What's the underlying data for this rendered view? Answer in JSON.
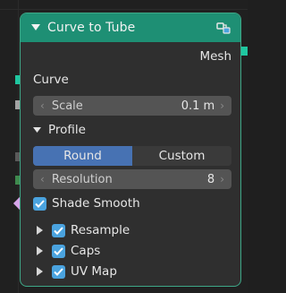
{
  "node": {
    "title": "Curve to Tube",
    "output_label": "Mesh",
    "input_curve_label": "Curve",
    "scale": {
      "label": "Scale",
      "value": "0.1 m"
    },
    "profile": {
      "label": "Profile",
      "options": [
        "Round",
        "Custom"
      ],
      "selected": "Round"
    },
    "resolution": {
      "label": "Resolution",
      "value": "8"
    },
    "shade_smooth": {
      "label": "Shade Smooth",
      "checked": true
    },
    "panels": [
      {
        "label": "Resample",
        "checked": true
      },
      {
        "label": "Caps",
        "checked": true
      },
      {
        "label": "UV Map",
        "checked": true
      }
    ]
  },
  "colors": {
    "header": "#1e8f74",
    "border": "#3ea888",
    "body": "#2f2f2f",
    "field": "#545454",
    "active_option": "#4772b3",
    "checkbox": "#4aa3df",
    "socket_geometry": "#1fc7a0",
    "socket_float": "#a3a3a3",
    "socket_int": "#3f8a4e",
    "socket_bool": "#d7a6ea"
  },
  "icons": {
    "collapse": "chevron-down-icon",
    "node_group": "node-group-icon",
    "expand": "triangle-right-icon",
    "check": "check-icon"
  }
}
